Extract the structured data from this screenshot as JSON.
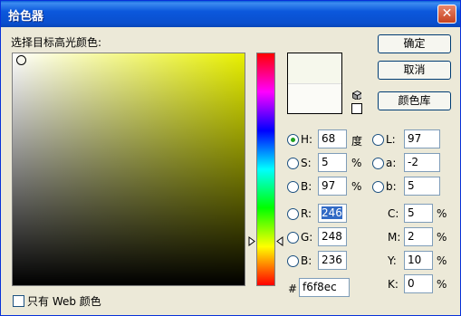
{
  "window": {
    "title": "拾色器",
    "close_label": "✕"
  },
  "picker": {
    "label": "选择目标高光颜色:"
  },
  "buttons": {
    "ok": "确定",
    "cancel": "取消",
    "library": "颜色库"
  },
  "hsb": {
    "h": {
      "label": "H:",
      "value": "68",
      "unit": "度"
    },
    "s": {
      "label": "S:",
      "value": "5",
      "unit": "%"
    },
    "b": {
      "label": "B:",
      "value": "97",
      "unit": "%"
    }
  },
  "lab": {
    "l": {
      "label": "L:",
      "value": "97"
    },
    "a": {
      "label": "a:",
      "value": "-2"
    },
    "b": {
      "label": "b:",
      "value": "5"
    }
  },
  "rgb": {
    "r": {
      "label": "R:",
      "value": "246"
    },
    "g": {
      "label": "G:",
      "value": "248"
    },
    "b": {
      "label": "B:",
      "value": "236"
    }
  },
  "cmyk": {
    "c": {
      "label": "C:",
      "value": "5",
      "unit": "%"
    },
    "m": {
      "label": "M:",
      "value": "2",
      "unit": "%"
    },
    "y": {
      "label": "Y:",
      "value": "10",
      "unit": "%"
    },
    "k": {
      "label": "K:",
      "value": "0",
      "unit": "%"
    }
  },
  "hex": {
    "label": "#",
    "value": "f6f8ec"
  },
  "websafe": {
    "label": "只有 Web 颜色"
  },
  "colors": {
    "new": "#f6f8ec",
    "current": "#fbfbf7",
    "title_bar": "#0a4fce"
  },
  "selected_mode": "H"
}
